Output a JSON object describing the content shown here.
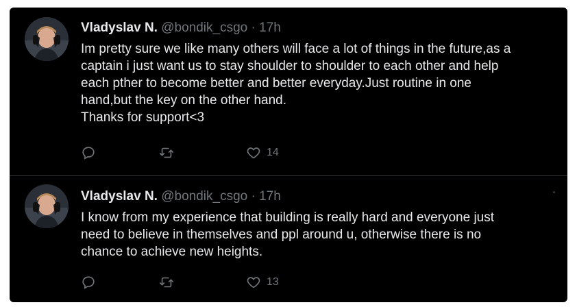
{
  "tweets": [
    {
      "author_name": "Vladyslav N.",
      "handle": "@bondik_csgo",
      "separator": "·",
      "time": "17h",
      "lines": [
        "Im pretty sure we like many others will face a lot of things in the future,as a",
        "captain i just want us to stay shoulder to shoulder to each other and help",
        "each pther to become better and better everyday.Just routine in one",
        "hand,but the key on the other hand.",
        "Thanks for support<3"
      ],
      "actions": {
        "reply_icon": "reply-icon",
        "retweet_icon": "retweet-icon",
        "like_icon": "heart-icon",
        "likes": "14"
      }
    },
    {
      "author_name": "Vladyslav N.",
      "handle": "@bondik_csgo",
      "separator": "·",
      "time": "17h",
      "lines": [
        "I know from my experience that building is really hard and everyone just",
        "need to believe in themselves and ppl around u, otherwise there is no",
        "chance to achieve new heights."
      ],
      "actions": {
        "reply_icon": "reply-icon",
        "retweet_icon": "retweet-icon",
        "like_icon": "heart-icon",
        "likes": "13"
      }
    }
  ],
  "colors": {
    "background": "#000000",
    "text": "#e7e9ea",
    "muted": "#71767b",
    "divider": "#2f3336"
  }
}
